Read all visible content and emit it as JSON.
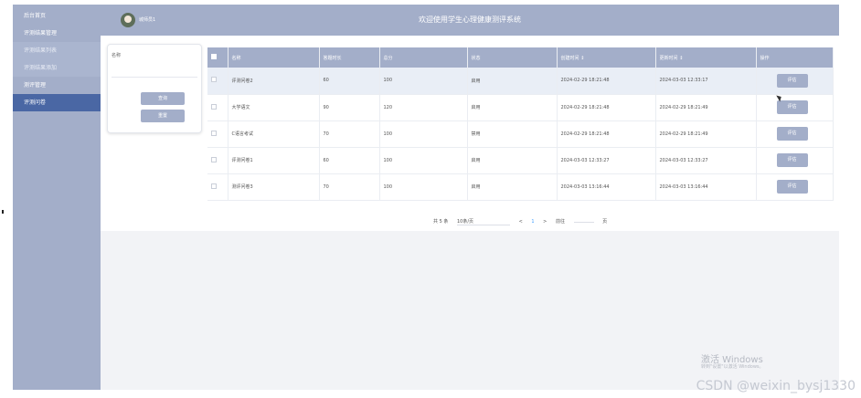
{
  "sidebar": {
    "items": [
      {
        "label": "后台首页"
      },
      {
        "label": "评测结果管理"
      },
      {
        "label": "评测结果列表"
      },
      {
        "label": "评测结果添加"
      },
      {
        "label": "测评管理"
      },
      {
        "label": "评测问卷"
      }
    ]
  },
  "header": {
    "username": "城师员1",
    "title": "欢迎使用学生心理健康测评系统"
  },
  "search": {
    "label": "名称",
    "placeholder": "",
    "query_button": "查询",
    "reset_button": "重置"
  },
  "table": {
    "headers": [
      "名称",
      "答题时长",
      "总分",
      "状态",
      "创建时间 ↕",
      "更新时间 ↕",
      "操作"
    ],
    "rows": [
      {
        "name": "评测问卷2",
        "duration": "60",
        "score": "100",
        "status": "启用",
        "created": "2024-02-29 18:21:48",
        "updated": "2024-03-03 12:33:17",
        "action": "评估"
      },
      {
        "name": "大学语文",
        "duration": "90",
        "score": "120",
        "status": "启用",
        "created": "2024-02-29 18:21:48",
        "updated": "2024-02-29 18:21:49",
        "action": "评估"
      },
      {
        "name": "C语言考试",
        "duration": "70",
        "score": "100",
        "status": "禁用",
        "created": "2024-02-29 18:21:48",
        "updated": "2024-02-29 18:21:49",
        "action": "评估"
      },
      {
        "name": "评测问卷1",
        "duration": "60",
        "score": "100",
        "status": "启用",
        "created": "2024-03-03 12:33:27",
        "updated": "2024-03-03 12:33:27",
        "action": "评估"
      },
      {
        "name": "测评问卷3",
        "duration": "70",
        "score": "100",
        "status": "启用",
        "created": "2024-03-03 13:16:44",
        "updated": "2024-03-03 13:16:44",
        "action": "评估"
      }
    ]
  },
  "pagination": {
    "total": "共 5 条",
    "page_size": "10条/页",
    "prev": "<",
    "current": "1",
    "next": ">",
    "goto": "前往",
    "page_unit": "页"
  },
  "watermark": {
    "line1": "激活 Windows",
    "line2": "转到\"设置\"以激活 Windows。",
    "csdn": "CSDN @weixin_bysj1330"
  }
}
